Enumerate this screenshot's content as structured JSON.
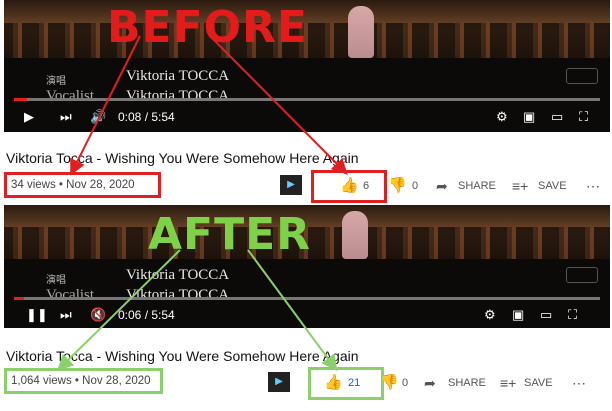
{
  "before": {
    "overlay_label": "BEFORE",
    "overlay_color": "#e31b1b",
    "subtitles": {
      "chinese": "演唱",
      "role": "Vocalist",
      "name_line1": "Viktoria TOCCA",
      "name_line2": "Viktoria TOCCA"
    },
    "player": {
      "time": "0:08 / 5:54",
      "progress": 0.023,
      "state": "paused-icon-play"
    },
    "title": "Viktoria Tocca - Wishing You Were Somehow Here Again",
    "meta": "34 views • Nov 28, 2020",
    "likes": "6",
    "dislikes": "0",
    "share_label": "SHARE",
    "save_label": "SAVE",
    "highlight_color": "#e02020"
  },
  "after": {
    "overlay_label": "AFTER",
    "overlay_color": "#7fd14a",
    "subtitles": {
      "chinese": "演唱",
      "role": "Vocalist",
      "name_line1": "Viktoria TOCCA",
      "name_line2": "Viktoria TOCCA"
    },
    "player": {
      "time": "0:06 / 5:54",
      "progress": 0.017,
      "state": "playing-icon-pause"
    },
    "title": "Viktoria Tocca - Wishing You Were Somehow Here Again",
    "meta": "1,064 views • Nov 28, 2020",
    "likes": "21",
    "dislikes": "0",
    "share_label": "SHARE",
    "save_label": "SAVE",
    "highlight_color": "#8bd06a"
  },
  "icons": [
    "play-icon",
    "pause-icon",
    "next-icon",
    "volume-icon",
    "muted-icon",
    "settings-icon",
    "miniplayer-icon",
    "theater-icon",
    "fullscreen-icon",
    "thumbs-up-icon",
    "thumbs-down-icon",
    "share-icon",
    "save-icon",
    "more-icon",
    "channel-avatar-icon"
  ]
}
